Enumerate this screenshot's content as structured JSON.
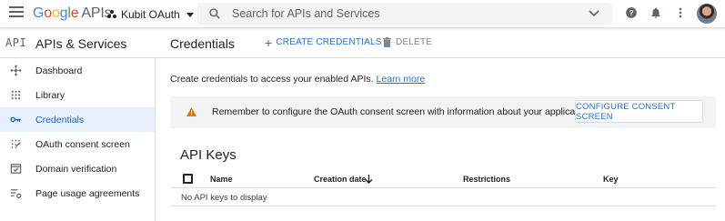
{
  "topbar": {
    "logo_google": "Google",
    "logo_apis": "APIs",
    "project_name": "Kubit OAuth",
    "search_placeholder": "Search for APIs and Services"
  },
  "header": {
    "product_logo": "API",
    "product_title": "APIs & Services",
    "page_title": "Credentials",
    "create_label": "CREATE CREDENTIALS",
    "delete_label": "DELETE"
  },
  "sidebar": {
    "items": [
      {
        "label": "Dashboard",
        "icon": "dashboard-icon",
        "active": false
      },
      {
        "label": "Library",
        "icon": "library-icon",
        "active": false
      },
      {
        "label": "Credentials",
        "icon": "key-icon",
        "active": true
      },
      {
        "label": "OAuth consent screen",
        "icon": "consent-icon",
        "active": false
      },
      {
        "label": "Domain verification",
        "icon": "domain-verification-icon",
        "active": false
      },
      {
        "label": "Page usage agreements",
        "icon": "settings-list-icon",
        "active": false
      }
    ]
  },
  "main": {
    "intro_text": "Create credentials to access your enabled APIs.",
    "learn_more": "Learn more",
    "banner_message": "Remember to configure the OAuth consent screen with information about your application.",
    "banner_button": "CONFIGURE CONSENT SCREEN",
    "section_title": "API Keys",
    "table": {
      "columns": [
        "Name",
        "Creation date",
        "Restrictions",
        "Key"
      ],
      "sort_column": "Creation date",
      "empty_text": "No API keys to display"
    }
  },
  "colors": {
    "accent": "#1a73e8",
    "active_bg": "#e8f0fe",
    "warning": "#e37400",
    "banner_bg": "#f1f3f4"
  }
}
